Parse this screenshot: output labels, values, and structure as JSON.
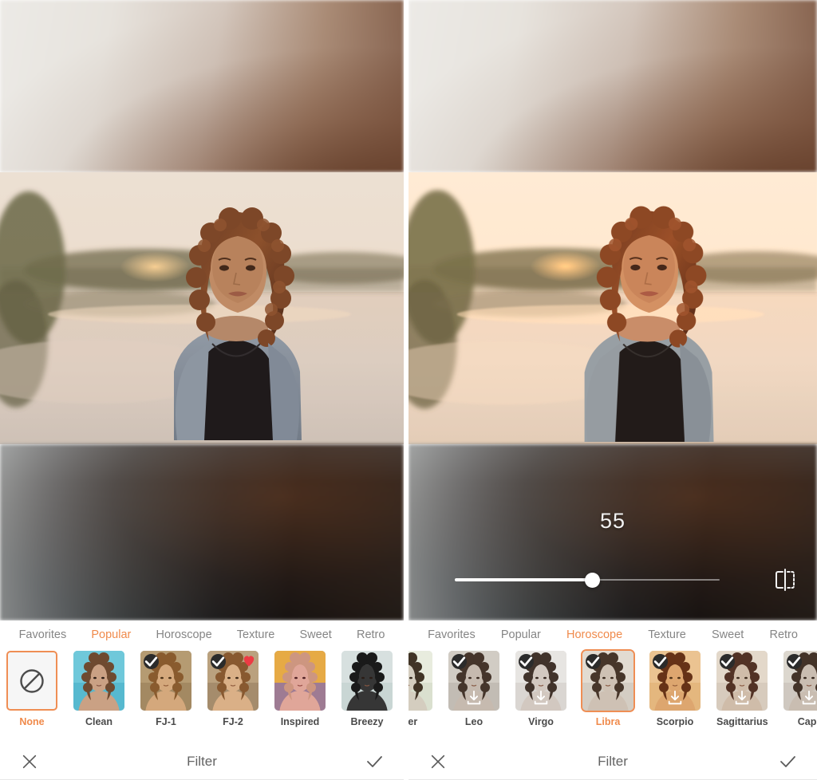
{
  "app": {
    "screen_title": "Filter",
    "accent_color": "#f08a4b",
    "selected_border_color": "#ef8e54"
  },
  "left_panel": {
    "name": "filter-screen-popular",
    "photo": {
      "alt": "woman with curly hair by a lake at sunset"
    },
    "slider_visible": false,
    "tabs": [
      {
        "label": "Favorites",
        "active": false
      },
      {
        "label": "Popular",
        "active": true
      },
      {
        "label": "Horoscope",
        "active": false
      },
      {
        "label": "Texture",
        "active": false
      },
      {
        "label": "Sweet",
        "active": false
      },
      {
        "label": "Retro",
        "active": false
      }
    ],
    "filters": [
      {
        "label": "None",
        "selected": true,
        "kind": "none",
        "checked": false,
        "favorited": false,
        "downloadable": false
      },
      {
        "label": "Clean",
        "selected": false,
        "kind": "photo",
        "checked": false,
        "favorited": false,
        "downloadable": false
      },
      {
        "label": "FJ-1",
        "selected": false,
        "kind": "photo",
        "checked": true,
        "favorited": false,
        "downloadable": false
      },
      {
        "label": "FJ-2",
        "selected": false,
        "kind": "photo",
        "checked": true,
        "favorited": true,
        "downloadable": false
      },
      {
        "label": "Inspired",
        "selected": false,
        "kind": "photo",
        "checked": false,
        "favorited": false,
        "downloadable": false
      },
      {
        "label": "Breezy",
        "selected": false,
        "kind": "photo",
        "checked": false,
        "favorited": false,
        "downloadable": false
      },
      {
        "label": "",
        "selected": false,
        "kind": "photo",
        "checked": false,
        "favorited": false,
        "downloadable": false
      }
    ],
    "actions": {
      "cancel_icon": "close-icon",
      "confirm_icon": "check-icon",
      "title": "Filter"
    }
  },
  "right_panel": {
    "name": "filter-screen-horoscope",
    "photo": {
      "alt": "woman with curly hair by a lake at sunset, Libra filter applied"
    },
    "slider": {
      "value": "55",
      "percent": 52,
      "min": 0,
      "max": 100,
      "compare_icon": "compare-split-icon"
    },
    "tabs": [
      {
        "label": "Favorites",
        "active": false
      },
      {
        "label": "Popular",
        "active": false
      },
      {
        "label": "Horoscope",
        "active": true
      },
      {
        "label": "Texture",
        "active": false
      },
      {
        "label": "Sweet",
        "active": false
      },
      {
        "label": "Retro",
        "active": false
      }
    ],
    "filters": [
      {
        "label": "ncer",
        "selected": false,
        "kind": "photo",
        "checked": false,
        "favorited": false,
        "downloadable": false
      },
      {
        "label": "Leo",
        "selected": false,
        "kind": "photo",
        "checked": true,
        "favorited": false,
        "downloadable": true
      },
      {
        "label": "Virgo",
        "selected": false,
        "kind": "photo",
        "checked": true,
        "favorited": false,
        "downloadable": true
      },
      {
        "label": "Libra",
        "selected": true,
        "kind": "photo",
        "checked": true,
        "favorited": false,
        "downloadable": false
      },
      {
        "label": "Scorpio",
        "selected": false,
        "kind": "photo",
        "checked": true,
        "favorited": false,
        "downloadable": true
      },
      {
        "label": "Sagittarius",
        "selected": false,
        "kind": "photo",
        "checked": true,
        "favorited": false,
        "downloadable": true
      },
      {
        "label": "Capr",
        "selected": false,
        "kind": "photo",
        "checked": true,
        "favorited": false,
        "downloadable": true
      }
    ],
    "actions": {
      "cancel_icon": "close-icon",
      "confirm_icon": "check-icon",
      "title": "Filter"
    }
  }
}
